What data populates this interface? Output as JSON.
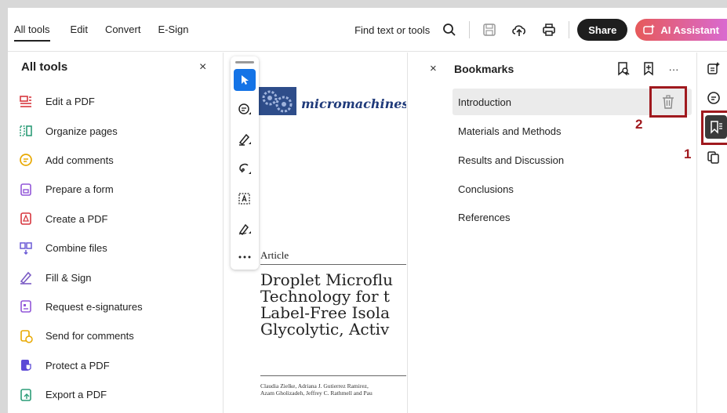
{
  "menubar": {
    "tabs": [
      "All tools",
      "Edit",
      "Convert",
      "E-Sign"
    ],
    "find_text": "Find text or tools",
    "share_label": "Share",
    "ai_label": "AI Assistant"
  },
  "left_panel": {
    "title": "All tools",
    "close": "×",
    "tools": [
      {
        "label": "Edit a PDF",
        "icon": "edit-pdf-icon",
        "color": "#d7373f"
      },
      {
        "label": "Organize pages",
        "icon": "organize-pages-icon",
        "color": "#2d9d78"
      },
      {
        "label": "Add comments",
        "icon": "comment-icon",
        "color": "#e8a800"
      },
      {
        "label": "Prepare a form",
        "icon": "form-icon",
        "color": "#9256d9"
      },
      {
        "label": "Create a PDF",
        "icon": "create-pdf-icon",
        "color": "#d7373f"
      },
      {
        "label": "Combine files",
        "icon": "combine-files-icon",
        "color": "#6b5bd6"
      },
      {
        "label": "Fill & Sign",
        "icon": "fill-sign-icon",
        "color": "#7b5cc4"
      },
      {
        "label": "Request e-signatures",
        "icon": "request-signature-icon",
        "color": "#9256d9"
      },
      {
        "label": "Send for comments",
        "icon": "send-comments-icon",
        "color": "#e8a800"
      },
      {
        "label": "Protect a PDF",
        "icon": "protect-pdf-icon",
        "color": "#5c4ad6"
      },
      {
        "label": "Export a PDF",
        "icon": "export-pdf-icon",
        "color": "#2d9d78"
      }
    ]
  },
  "document": {
    "journal": "micromachines",
    "article_type": "Article",
    "title_lines": [
      "Droplet Microflu",
      "Technology for t",
      "Label-Free Isola",
      "Glycolytic, Activ"
    ],
    "author_lines": [
      "Claudia Zielke, Adriana J. Gutierrez Ramirez,",
      "Azam Gholizadeh, Jeffrey C. Rathmell and Pau"
    ]
  },
  "bookmarks": {
    "close": "×",
    "title": "Bookmarks",
    "more": "···",
    "items": [
      "Introduction",
      "Materials and Methods",
      "Results and Discussion",
      "Conclusions",
      "References"
    ]
  },
  "callouts": {
    "one": "1",
    "two": "2"
  },
  "colors": {
    "accent": "#1473e6",
    "callout": "#a0191e",
    "share": "#1e1e1e"
  }
}
